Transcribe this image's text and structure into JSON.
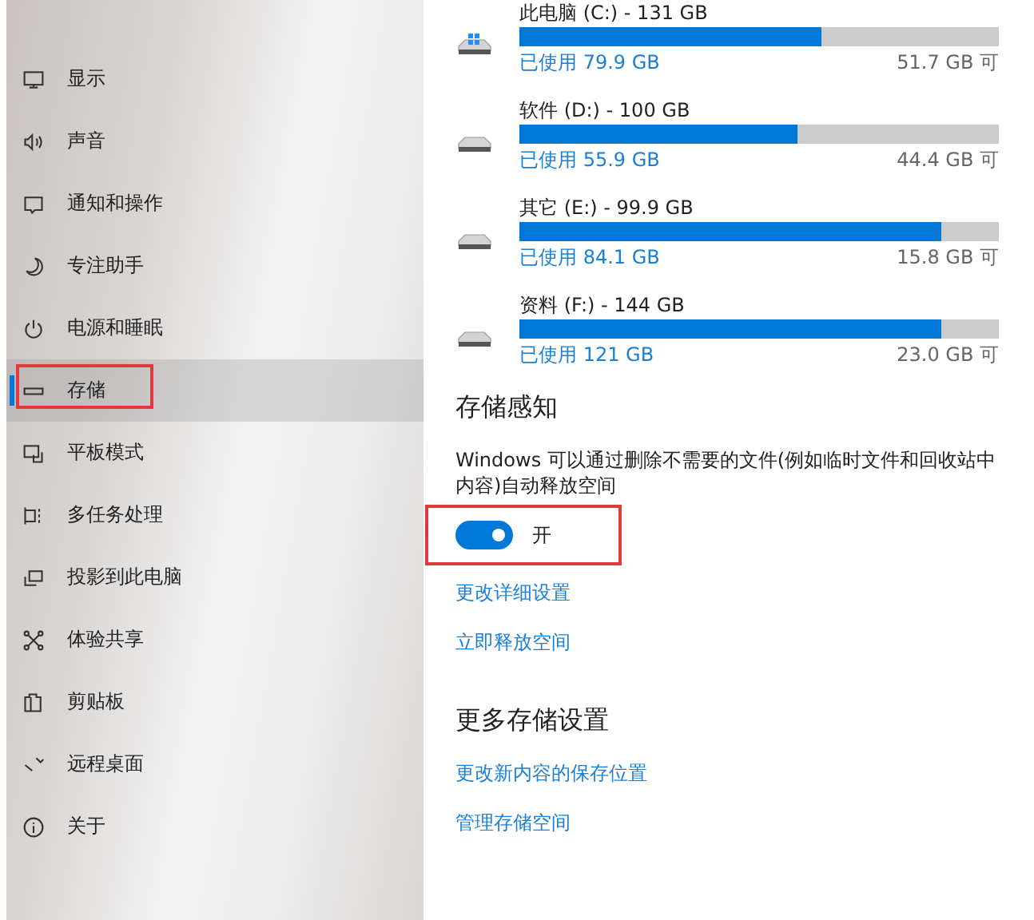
{
  "sidebar": {
    "items": [
      {
        "label": "显示",
        "selected": false,
        "highlighted": false
      },
      {
        "label": "声音",
        "selected": false,
        "highlighted": false
      },
      {
        "label": "通知和操作",
        "selected": false,
        "highlighted": false
      },
      {
        "label": "专注助手",
        "selected": false,
        "highlighted": false
      },
      {
        "label": "电源和睡眠",
        "selected": false,
        "highlighted": false
      },
      {
        "label": "存储",
        "selected": true,
        "highlighted": true
      },
      {
        "label": "平板模式",
        "selected": false,
        "highlighted": false
      },
      {
        "label": "多任务处理",
        "selected": false,
        "highlighted": false
      },
      {
        "label": "投影到此电脑",
        "selected": false,
        "highlighted": false
      },
      {
        "label": "体验共享",
        "selected": false,
        "highlighted": false
      },
      {
        "label": "剪贴板",
        "selected": false,
        "highlighted": false
      },
      {
        "label": "远程桌面",
        "selected": false,
        "highlighted": false
      },
      {
        "label": "关于",
        "selected": false,
        "highlighted": false
      }
    ]
  },
  "drives": [
    {
      "kind": "system",
      "title": "此电脑 (C:) - 131 GB",
      "level": 0.63,
      "used": "已使用 79.9 GB",
      "free": "51.7 GB 可"
    },
    {
      "kind": "data",
      "title": "软件 (D:) - 100 GB",
      "level": 0.58,
      "used": "已使用 55.9 GB",
      "free": "44.4 GB 可"
    },
    {
      "kind": "data",
      "title": "其它 (E:) - 99.9 GB",
      "level": 0.88,
      "used": "已使用 84.1 GB",
      "free": "15.8 GB 可"
    },
    {
      "kind": "data",
      "title": "资料 (F:) - 144 GB",
      "level": 0.88,
      "used": "已使用 121 GB",
      "free": "23.0 GB 可"
    }
  ],
  "storage_sense": {
    "heading": "存储感知",
    "description_lines": [
      "Windows 可以通过删除不需要的文件(例如临时文件和回收站中",
      "内容)自动释放空间"
    ],
    "toggle": {
      "on": true,
      "label": "开",
      "highlighted": true
    },
    "links": [
      "更改详细设置",
      "立即释放空间"
    ]
  },
  "more_settings": {
    "heading": "更多存储设置",
    "links": [
      "更改新内容的保存位置",
      "管理存储空间"
    ]
  }
}
